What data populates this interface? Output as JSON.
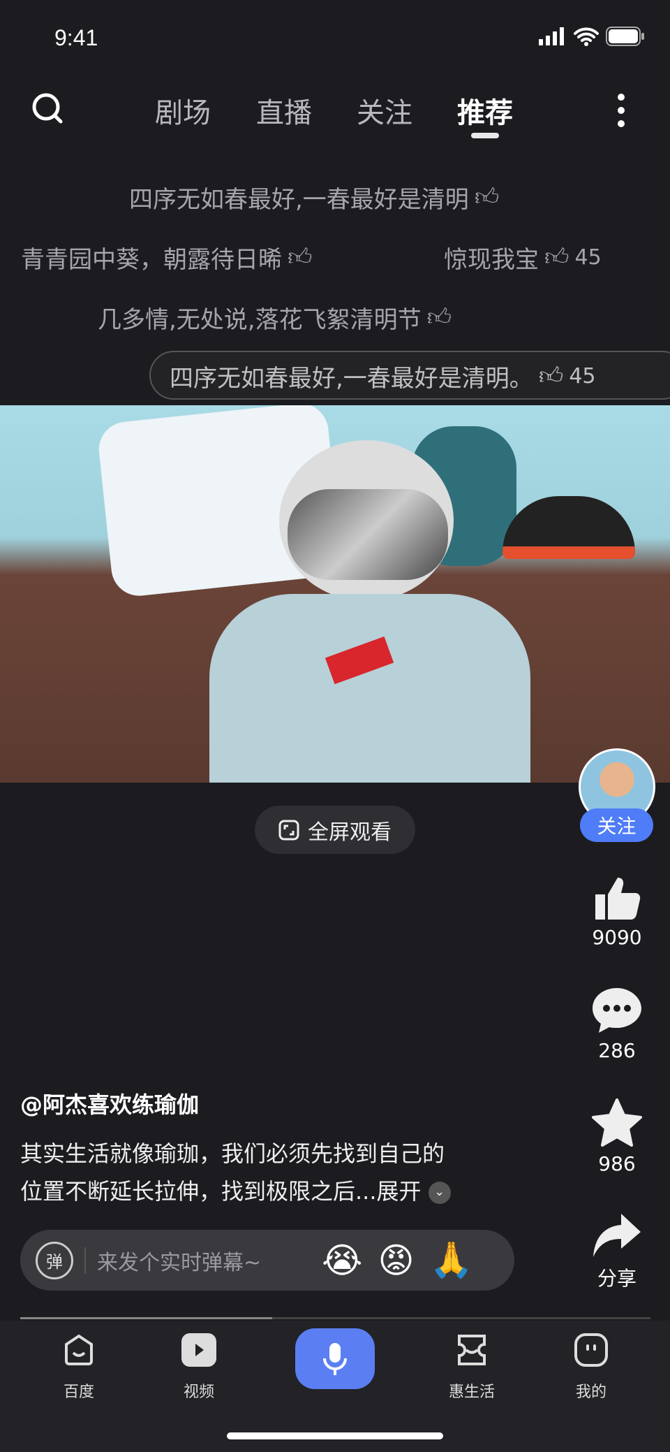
{
  "status": {
    "time": "9:41"
  },
  "nav": {
    "tabs": [
      {
        "label": "剧场"
      },
      {
        "label": "直播"
      },
      {
        "label": "关注"
      },
      {
        "label": "推荐",
        "active": true
      }
    ]
  },
  "danmaku": [
    {
      "text": "四序无如春最好,一春最好是清明",
      "count": ""
    },
    {
      "text": "青青园中葵，朝露待日晞",
      "count": ""
    },
    {
      "text": "惊现我宝",
      "count": "45"
    },
    {
      "text": "几多情,无处说,落花飞絮清明节",
      "count": ""
    },
    {
      "text": "四序无如春最好,一春最好是清明。",
      "count": "45"
    }
  ],
  "video": {
    "fullscreen_label": "全屏观看"
  },
  "side": {
    "follow_label": "关注",
    "likes": "9090",
    "comments": "286",
    "favorites": "986",
    "share_label": "分享"
  },
  "post": {
    "username": "@阿杰喜欢练瑜伽",
    "desc_line1": "其实生活就像瑜珈，我们必须先找到自己的",
    "desc_line2": "位置不断延长拉伸，找到极限之后...",
    "expand_label": "展开",
    "progress": 0.4
  },
  "danmaku_input": {
    "placeholder": "来发个实时弹幕~",
    "toggle_label": "弹",
    "emojis": [
      "😭",
      "😡",
      "🙏"
    ]
  },
  "bottom_nav": [
    {
      "label": "百度"
    },
    {
      "label": "视频"
    },
    {
      "label": "惠生活"
    },
    {
      "label": "我的"
    }
  ],
  "colors": {
    "accent": "#4f7cf7",
    "mic": "#5b7ff2",
    "background": "#1c1c20"
  }
}
